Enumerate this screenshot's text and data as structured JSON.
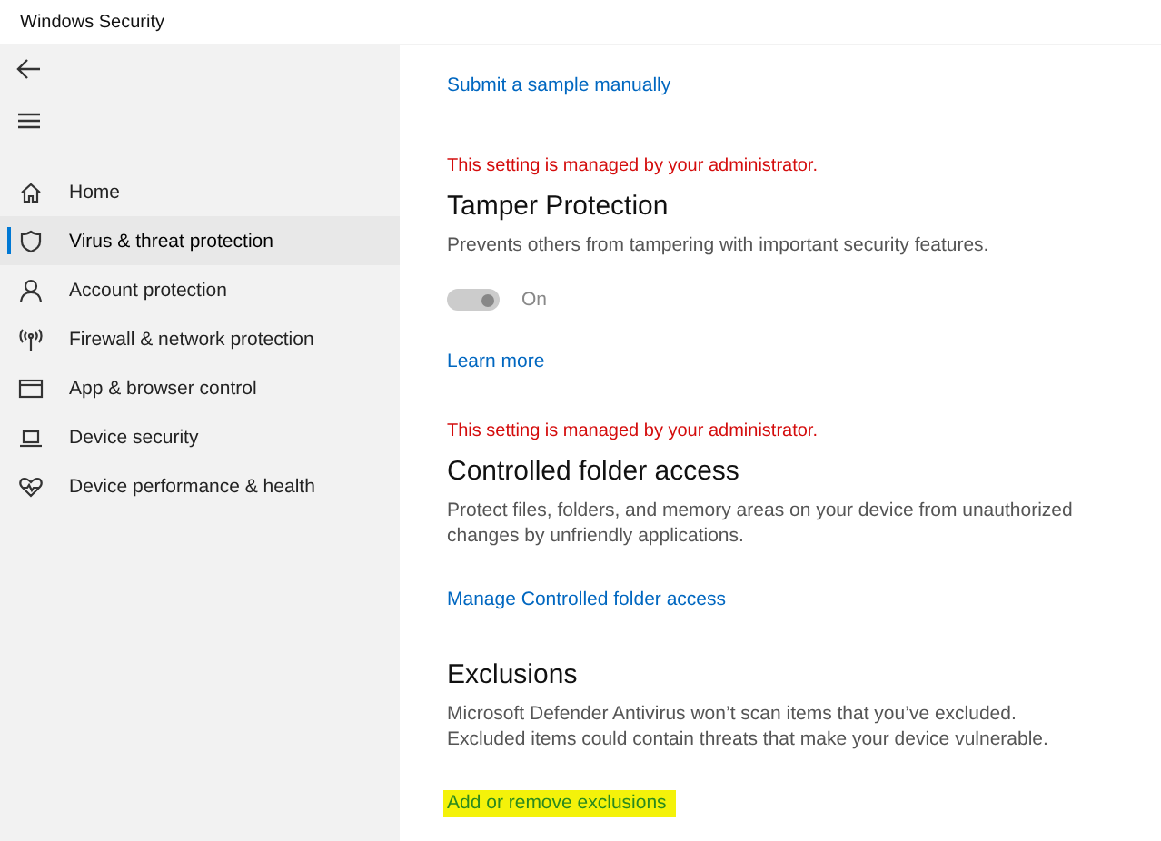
{
  "window": {
    "title": "Windows Security"
  },
  "sidebar": {
    "items": [
      {
        "label": "Home",
        "selected": false
      },
      {
        "label": "Virus & threat protection",
        "selected": true
      },
      {
        "label": "Account protection",
        "selected": false
      },
      {
        "label": "Firewall & network protection",
        "selected": false
      },
      {
        "label": "App & browser control",
        "selected": false
      },
      {
        "label": "Device security",
        "selected": false
      },
      {
        "label": "Device performance & health",
        "selected": false
      }
    ]
  },
  "content": {
    "top_link": "Submit a sample manually",
    "sections": [
      {
        "notice": "This setting is managed by your administrator.",
        "title": "Tamper Protection",
        "description": "Prevents others from tampering with important security features.",
        "toggle": {
          "on": true,
          "disabled": true,
          "label": "On"
        },
        "link": {
          "label": "Learn more",
          "highlighted": false
        }
      },
      {
        "notice": "This setting is managed by your administrator.",
        "title": "Controlled folder access",
        "description": "Protect files, folders, and memory areas on your device from unauthorized changes by unfriendly applications.",
        "link": {
          "label": "Manage Controlled folder access",
          "highlighted": false
        }
      },
      {
        "title": "Exclusions",
        "description": "Microsoft Defender Antivirus won’t scan items that you’ve excluded. Excluded items could contain threats that make your device vulnerable.",
        "link": {
          "label": "Add or remove exclusions",
          "highlighted": true
        }
      }
    ]
  }
}
